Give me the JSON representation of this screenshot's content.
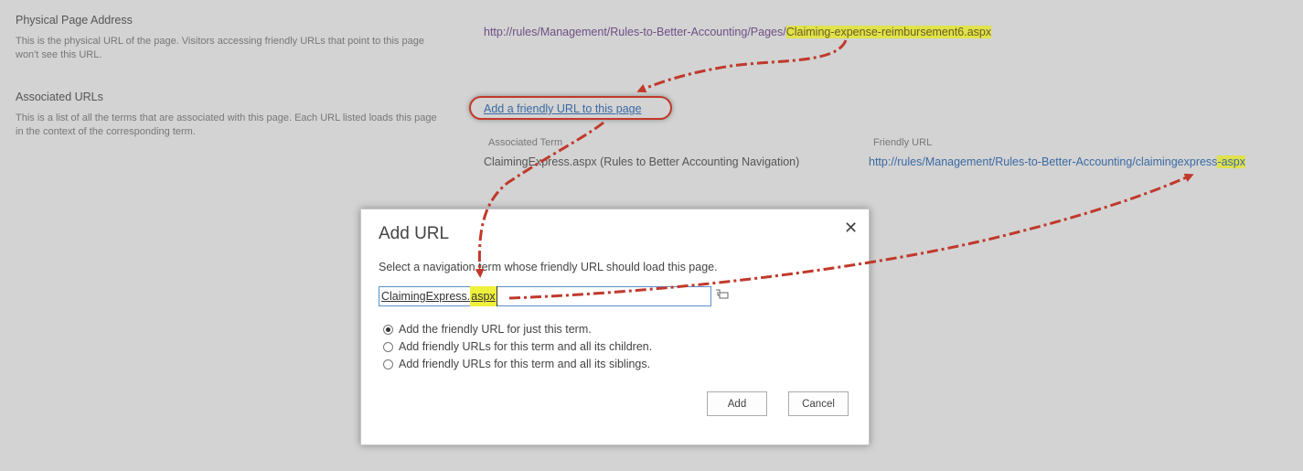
{
  "physical": {
    "title": "Physical Page Address",
    "desc": "This is the physical URL of the page.  Visitors accessing friendly URLs that point to this page won't see this URL.",
    "url_prefix": "http://rules/Management/Rules-to-Better-Accounting/Pages/",
    "url_highlight": "Claiming-expense-reimbursement6.aspx"
  },
  "associated": {
    "title": "Associated URLs",
    "desc": "This is a list of all the terms that are associated with this page.  Each URL listed loads this page in the context of the corresponding term.",
    "add_link": "Add a friendly URL to this page",
    "col_term": "Associated Term",
    "col_url": "Friendly URL",
    "rows": [
      {
        "term": "ClaimingExpress.aspx (Rules to Better Accounting Navigation)",
        "url_prefix": "http://rules/Management/Rules-to-Better-Accounting/claimingexpress",
        "url_highlight": "-aspx"
      }
    ]
  },
  "dialog": {
    "title": "Add URL",
    "close": "✕",
    "instruction": "Select a navigation term whose friendly URL should load this page.",
    "input_prefix": "ClaimingExpress.",
    "input_highlight": "aspx",
    "options": [
      {
        "label": "Add the friendly URL for just this term.",
        "checked": true
      },
      {
        "label": "Add friendly URLs for this term and all its children.",
        "checked": false
      },
      {
        "label": "Add friendly URLs for this term and all its siblings.",
        "checked": false
      }
    ],
    "add_button": "Add",
    "cancel_button": "Cancel"
  },
  "colors": {
    "background": "#d3d3d3",
    "annotation": "#c0392b",
    "highlight": "#e0e34a",
    "link_blue": "#3a6aa3",
    "link_purple": "#6e4f86"
  }
}
